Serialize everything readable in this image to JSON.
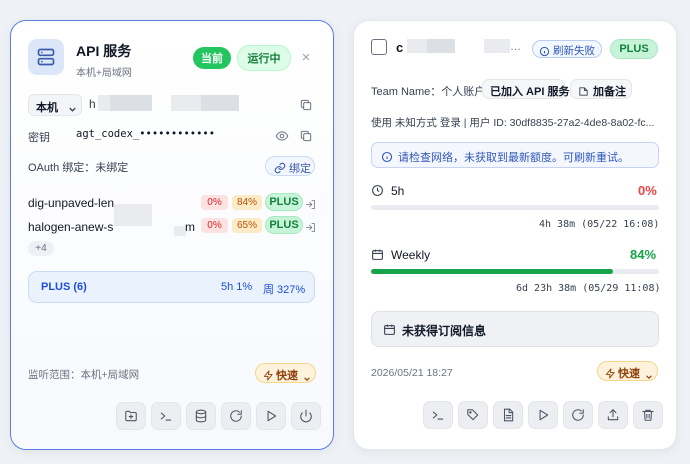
{
  "left": {
    "title": "API 服务",
    "subtitle": "本机+局域网",
    "badge_current": "当前",
    "badge_running": "运行中",
    "scope_select": "本机",
    "host_prefix": "h",
    "key_label": "密钥",
    "key_value": "agt_codex_••••••••••••",
    "oauth_label": "OAuth 绑定：未绑定",
    "bind_button": "绑定",
    "accounts": [
      {
        "name": "dig-unpaved-len",
        "usage_5h": "0%",
        "usage_week": "84%",
        "plan": "PLUS"
      },
      {
        "name": "halogen-anew-s",
        "name_suffix": "m",
        "usage_5h": "0%",
        "usage_week": "65%",
        "plan": "PLUS"
      }
    ],
    "more_count": "+4",
    "summary_plan": "PLUS (6)",
    "summary_5h": "5h 1%",
    "summary_week": "周 327%",
    "listen_scope": "监听范围：本机+局域网",
    "speed_label": "快速",
    "colors": {
      "accent": "#5b7fe0",
      "green": "#22c55e",
      "red": "#ef4444",
      "orange": "#f59e0b"
    }
  },
  "right": {
    "title_prefix": "c",
    "title_suffix": "…",
    "refresh_failed": "刷新失败",
    "plan_badge": "PLUS",
    "team_label": "Team Name：个人账户",
    "joined_api": "已加入 API 服务",
    "add_note": "加备注",
    "user_line": "使用 未知方式 登录 | 用户 ID: 30df8835-27a2-4de8-8a02-fc...",
    "network_notice": "请检查网络，未获取到最新额度。可刷新重试。",
    "window_5h": {
      "label": "5h",
      "percent": "0%",
      "reset": "4h 38m (05/22 16:08)",
      "fill": 0
    },
    "window_weekly": {
      "label": "Weekly",
      "percent": "84%",
      "reset": "6d 23h 38m (05/29 11:08)",
      "fill": 0.84
    },
    "subscription": "未获得订阅信息",
    "timestamp": "2026/05/21 18:27",
    "speed_label": "快速"
  }
}
